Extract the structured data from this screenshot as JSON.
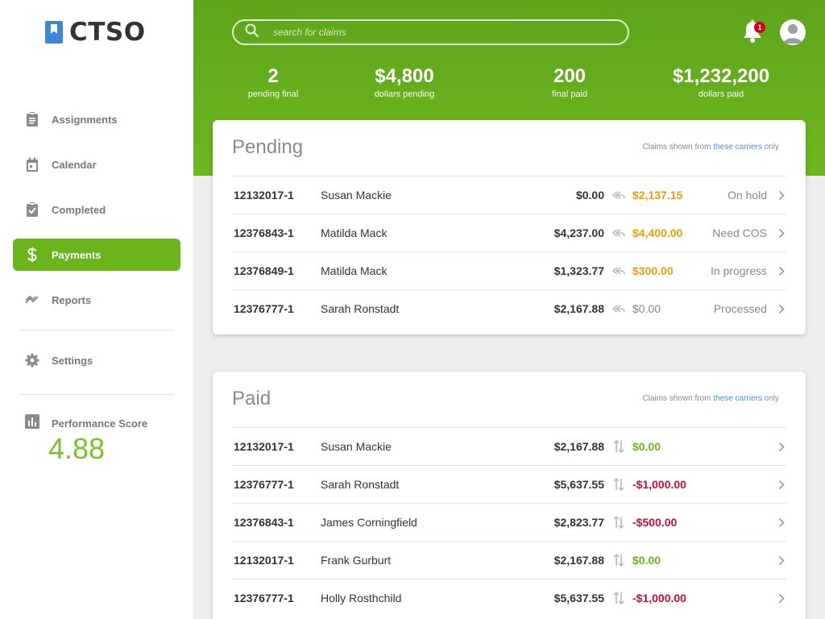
{
  "app": {
    "name": "CTSO"
  },
  "sidebar": {
    "items": [
      {
        "label": "Assignments",
        "icon": "clipboard-icon"
      },
      {
        "label": "Calendar",
        "icon": "calendar-icon"
      },
      {
        "label": "Completed",
        "icon": "clipboard-check-icon"
      },
      {
        "label": "Payments",
        "icon": "dollar-icon",
        "active": true
      },
      {
        "label": "Reports",
        "icon": "trend-icon"
      },
      {
        "label": "Settings",
        "icon": "gear-icon"
      }
    ],
    "performance": {
      "label": "Performance Score",
      "value": "4.88"
    }
  },
  "header": {
    "search_placeholder": "search for claims",
    "notifications": "1",
    "stats": [
      {
        "value": "2",
        "label": "pending final"
      },
      {
        "value": "$4,800",
        "label": "dollars pending"
      },
      {
        "value": "200",
        "label": "final paid"
      },
      {
        "value": "$1,232,200",
        "label": "dollars paid"
      }
    ]
  },
  "pending": {
    "title": "Pending",
    "note_prefix": "Claims shown from ",
    "note_link": "these carriers",
    "note_suffix": " only",
    "rows": [
      {
        "id": "12132017-1",
        "name": "Susan Mackie",
        "amount": "$0.00",
        "amount2": "$2,137.15",
        "status": "On hold"
      },
      {
        "id": "12376843-1",
        "name": "Matilda Mack",
        "amount": "$4,237.00",
        "amount2": "$4,400.00",
        "status": "Need COS"
      },
      {
        "id": "12376849-1",
        "name": "Matilda Mack",
        "amount": "$1,323.77",
        "amount2": "$300.00",
        "status": "In progress"
      },
      {
        "id": "12376777-1",
        "name": "Sarah Ronstadt",
        "amount": "$2,167.88",
        "amount2": "$0.00",
        "status": "Processed"
      }
    ]
  },
  "paid": {
    "title": "Paid",
    "note_prefix": "Claims shown from ",
    "note_link": "these carriers",
    "note_suffix": " only",
    "rows": [
      {
        "id": "12132017-1",
        "name": "Susan Mackie",
        "amount": "$2,167.88",
        "amount2": "$0.00"
      },
      {
        "id": "12376777-1",
        "name": "Sarah Ronstadt",
        "amount": "$5,637.55",
        "amount2": "-$1,000.00"
      },
      {
        "id": "12376843-1",
        "name": "James Corningfield",
        "amount": "$2,823.77",
        "amount2": "-$500.00"
      },
      {
        "id": "12132017-1",
        "name": "Frank Gurburt",
        "amount": "$2,167.88",
        "amount2": "$0.00"
      },
      {
        "id": "12376777-1",
        "name": "Holly Rosthchild",
        "amount": "$5,637.55",
        "amount2": "-$1,000.00"
      }
    ]
  },
  "colors": {
    "brand_green": "#6bb51c",
    "amber": "#e79e0e",
    "red": "#c8102e",
    "link": "#4a8fd8"
  }
}
